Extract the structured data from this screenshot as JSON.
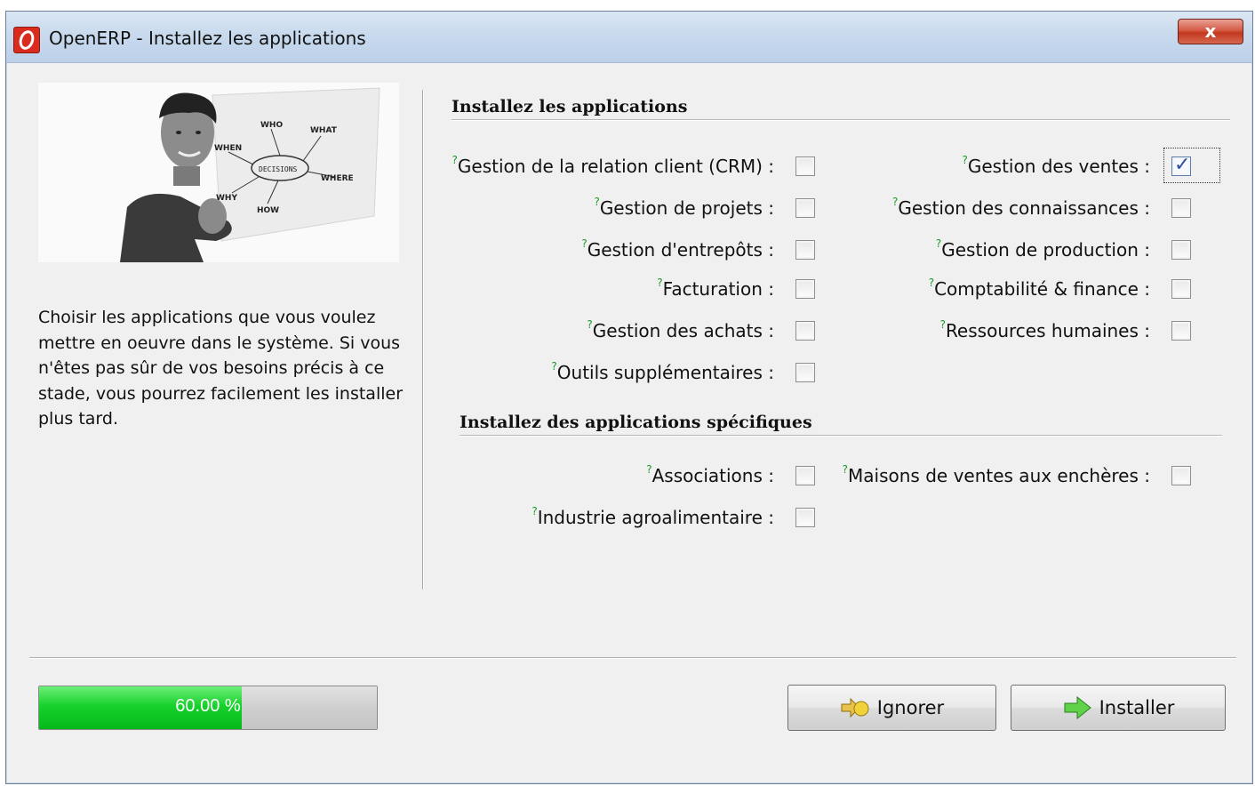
{
  "window": {
    "title": "OpenERP - Installez les applications",
    "close_label": "x"
  },
  "left_panel": {
    "image_words": [
      "WHO",
      "WHAT",
      "WHEN",
      "WHERE",
      "WHY",
      "HOW",
      "DECISIONS"
    ],
    "description": "Choisir les applications que vous voulez mettre en oeuvre dans le système. Si vous n'êtes pas sûr de vos besoins précis à ce stade, vous pourrez facilement les installer plus tard."
  },
  "sections": {
    "main_title": "Installez les applications",
    "specific_title": "Installez des applications spécifiques"
  },
  "help_marker": "?",
  "apps": {
    "crm": {
      "label": "Gestion de la relation client (CRM) :",
      "checked": false
    },
    "ventes": {
      "label": "Gestion des ventes :",
      "checked": true
    },
    "projets": {
      "label": "Gestion de projets :",
      "checked": false
    },
    "connaissances": {
      "label": "Gestion des connaissances :",
      "checked": false
    },
    "entrepots": {
      "label": "Gestion d'entrepôts :",
      "checked": false
    },
    "production": {
      "label": "Gestion de production :",
      "checked": false
    },
    "facturation": {
      "label": "Facturation :",
      "checked": false
    },
    "comptabilite": {
      "label": "Comptabilité & finance :",
      "checked": false
    },
    "achats": {
      "label": "Gestion des achats :",
      "checked": false
    },
    "rh": {
      "label": "Ressources humaines :",
      "checked": false
    },
    "outils": {
      "label": "Outils supplémentaires :",
      "checked": false
    },
    "associations": {
      "label": "Associations :",
      "checked": false
    },
    "encheres": {
      "label": "Maisons de ventes aux enchères :",
      "checked": false
    },
    "agro": {
      "label": "Industrie agroalimentaire :",
      "checked": false
    }
  },
  "progress": {
    "label": "60.00 %",
    "value": 60.0
  },
  "buttons": {
    "ignore": "Ignorer",
    "install": "Installer"
  },
  "colors": {
    "progress_green": "#17d12c",
    "help_marker": "#1a9a2a",
    "checkmark": "#2a4fa0"
  }
}
